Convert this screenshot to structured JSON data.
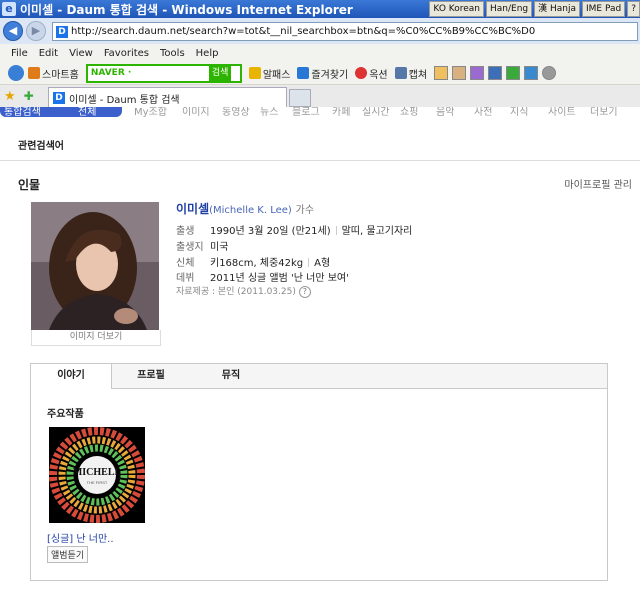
{
  "window": {
    "title": "이미셀 - Daum 통합 검색 - Windows Internet Explorer",
    "lang": [
      "KO Korean",
      "Han/Eng",
      "漢 Hanja",
      "IME Pad",
      "?"
    ]
  },
  "address": {
    "url": "http://search.daum.net/search?w=tot&t__nil_searchbox=btn&q=%C0%CC%B9%CC%BC%D0"
  },
  "menu": [
    "File",
    "Edit",
    "View",
    "Favorites",
    "Tools",
    "Help"
  ],
  "toolbar": {
    "smart_home": "스마트홈",
    "naver_label": "NAVER ·",
    "naver_search": "검색",
    "items": [
      "알패스",
      "즐겨찾기",
      "옥션",
      "캡쳐"
    ]
  },
  "tab": {
    "title": "이미셀 - Daum 통합 검색"
  },
  "daum_nav": {
    "items": [
      "통합검색",
      "전체",
      "My조합",
      "이미지",
      "동영상",
      "뉴스",
      "블로그",
      "카페",
      "실시간",
      "쇼핑",
      "음악",
      "사전",
      "지식",
      "사이트",
      "더보기"
    ]
  },
  "related_searches": "관련검색어",
  "person": {
    "section_title": "인물",
    "manage": "마이프로필 관리",
    "more_images": "이미지 더보기",
    "name": "이미셀",
    "name_en": "(Michelle K. Lee)",
    "job": "가수",
    "birth_label": "출생",
    "birth": "1990년 3월 20일 (만21세)",
    "birth_zodiac": "말띠, 물고기자리",
    "origin_label": "출생지",
    "origin": "미국",
    "body_label": "신체",
    "body": "키168cm, 체중42kg",
    "blood": "A형",
    "debut_label": "데뷔",
    "debut": "2011년 싱글 앨범 '난 너만 보여'",
    "source": "자료제공 : 본인 (2011.03.25)",
    "help": "?"
  },
  "content_tabs": [
    "이야기",
    "프로필",
    "뮤직"
  ],
  "works": {
    "title": "주요작품",
    "album_cover_text": "MICHELL",
    "album_cover_sub": "THE FIRST",
    "album_title": "[싱글] 난 너만..",
    "listen": "앨범듣기"
  }
}
